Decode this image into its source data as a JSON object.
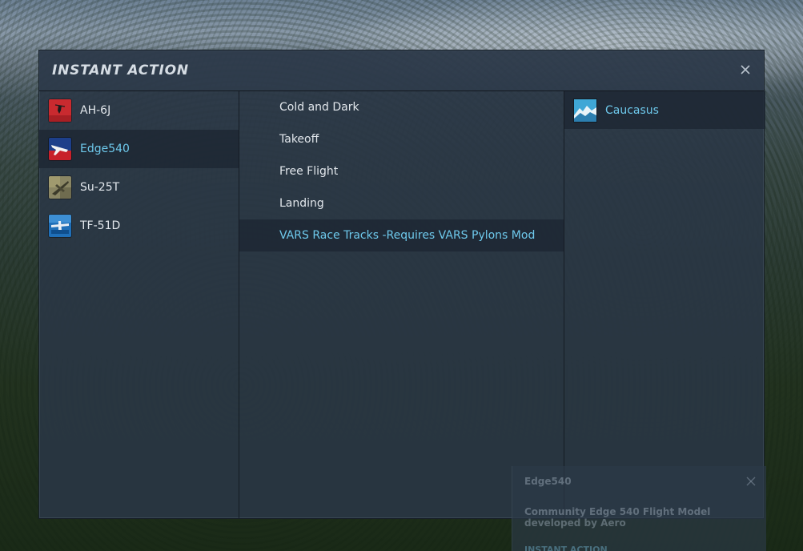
{
  "window": {
    "title": "INSTANT ACTION"
  },
  "aircraft": [
    {
      "label": "AH-6J",
      "icon": "ah-6j-icon",
      "selected": false
    },
    {
      "label": "Edge540",
      "icon": "edge540-icon",
      "selected": true
    },
    {
      "label": "Su-25T",
      "icon": "su-25t-icon",
      "selected": false
    },
    {
      "label": "TF-51D",
      "icon": "tf-51d-icon",
      "selected": false
    }
  ],
  "missions": [
    {
      "label": "Cold and Dark",
      "selected": false
    },
    {
      "label": "Takeoff",
      "selected": false
    },
    {
      "label": "Free Flight",
      "selected": false
    },
    {
      "label": "Landing",
      "selected": false
    },
    {
      "label": "VARS Race Tracks -Requires VARS Pylons Mod",
      "selected": true
    }
  ],
  "maps": [
    {
      "label": "Caucasus",
      "icon": "caucasus-map-icon",
      "badge": "CAUCASUS",
      "selected": true
    }
  ],
  "info_panel": {
    "title": "Edge540",
    "description": "Community Edge 540 Flight Model developed by Aero",
    "link": "INSTANT ACTION"
  },
  "colors": {
    "accent": "#6ec9ec",
    "text": "#e2e7ec",
    "panel": "#2a3746"
  }
}
